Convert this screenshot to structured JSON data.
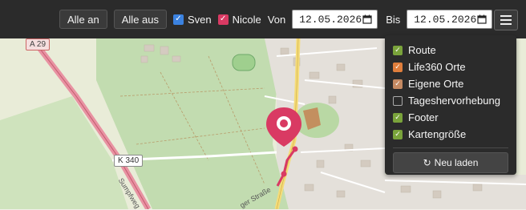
{
  "toolbar": {
    "all_on_label": "Alle an",
    "all_off_label": "Alle aus",
    "persons": [
      {
        "label": "Sven",
        "checked": true,
        "color": "#3b82e0"
      },
      {
        "label": "Nicole",
        "checked": true,
        "color": "#d93a63"
      }
    ],
    "from_label": "Von",
    "from_date": "12.05.2026",
    "to_label": "Bis",
    "to_date": "12.05.2026",
    "menu_icon": "hamburger-icon"
  },
  "menu": {
    "items": [
      {
        "label": "Route",
        "checked": true,
        "color": "#7aa33b"
      },
      {
        "label": "Life360 Orte",
        "checked": true,
        "color": "#e07e3c"
      },
      {
        "label": "Eigene Orte",
        "checked": true,
        "color": "#c58a63"
      },
      {
        "label": "Tageshervorhebung",
        "checked": false
      },
      {
        "label": "Footer",
        "checked": true,
        "color": "#7aa33b"
      },
      {
        "label": "Kartengröße",
        "checked": true,
        "color": "#7aa33b"
      }
    ],
    "reload_label": "Neu laden",
    "reload_icon": "refresh-icon"
  },
  "map": {
    "road_labels": {
      "motorway": "A 29",
      "county_road": "K 340",
      "street_sumpfweg": "Sumpfweg",
      "street_south": "ger Straße"
    },
    "marker_color": "#d93a63",
    "route_color": "#d93a63"
  }
}
